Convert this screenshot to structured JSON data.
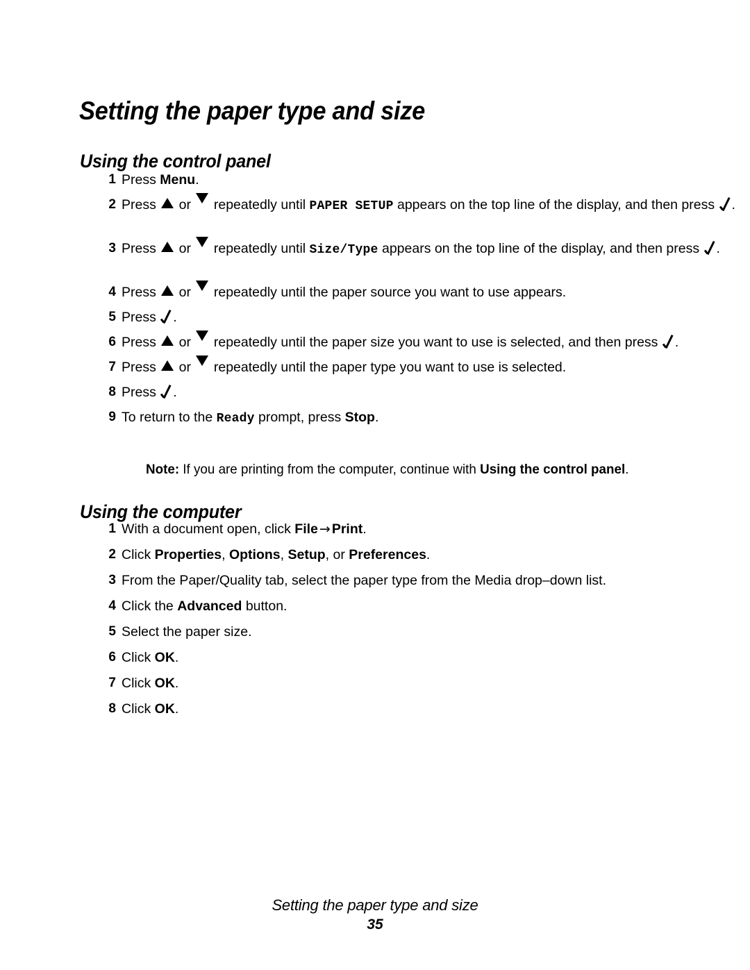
{
  "page": {
    "title": "Setting the paper type and size",
    "footer_title": "Setting the paper type and size",
    "page_number": "35"
  },
  "sections": [
    {
      "heading": "Using the control panel",
      "steps": [
        {
          "number": "1",
          "parts": [
            {
              "t": "text",
              "v": "Press "
            },
            {
              "t": "bold",
              "v": "Menu"
            },
            {
              "t": "text",
              "v": "."
            }
          ]
        },
        {
          "number": "2",
          "parts": [
            {
              "t": "text",
              "v": "Press "
            },
            {
              "t": "icon",
              "v": "triangle-up-icon"
            },
            {
              "t": "text",
              "v": " or "
            },
            {
              "t": "icon",
              "v": "triangle-down-icon"
            },
            {
              "t": "text",
              "v": " repeatedly until "
            },
            {
              "t": "code",
              "v": "PAPER SETUP"
            },
            {
              "t": "text",
              "v": " appears on the top line of the display, and then press "
            },
            {
              "t": "icon",
              "v": "check-icon"
            },
            {
              "t": "text",
              "v": "."
            }
          ]
        },
        {
          "number": "3",
          "parts": [
            {
              "t": "text",
              "v": "Press "
            },
            {
              "t": "icon",
              "v": "triangle-up-icon"
            },
            {
              "t": "text",
              "v": " or "
            },
            {
              "t": "icon",
              "v": "triangle-down-icon"
            },
            {
              "t": "text",
              "v": " repeatedly until "
            },
            {
              "t": "code",
              "v": "Size/Type"
            },
            {
              "t": "text",
              "v": " appears on the top line of the display, and then press "
            },
            {
              "t": "icon",
              "v": "check-icon"
            },
            {
              "t": "text",
              "v": "."
            }
          ]
        },
        {
          "number": "4",
          "parts": [
            {
              "t": "text",
              "v": "Press "
            },
            {
              "t": "icon",
              "v": "triangle-up-icon"
            },
            {
              "t": "text",
              "v": " or "
            },
            {
              "t": "icon",
              "v": "triangle-down-icon"
            },
            {
              "t": "text",
              "v": " repeatedly until the paper source you want to use appears."
            }
          ]
        },
        {
          "number": "5",
          "parts": [
            {
              "t": "text",
              "v": "Press "
            },
            {
              "t": "icon",
              "v": "check-icon"
            },
            {
              "t": "text",
              "v": "."
            }
          ]
        },
        {
          "number": "6",
          "parts": [
            {
              "t": "text",
              "v": "Press "
            },
            {
              "t": "icon",
              "v": "triangle-up-icon"
            },
            {
              "t": "text",
              "v": " or "
            },
            {
              "t": "icon",
              "v": "triangle-down-icon"
            },
            {
              "t": "text",
              "v": " repeatedly until the paper size you want to use is selected, and then press "
            },
            {
              "t": "icon",
              "v": "check-icon"
            },
            {
              "t": "text",
              "v": "."
            }
          ]
        },
        {
          "number": "7",
          "parts": [
            {
              "t": "text",
              "v": "Press "
            },
            {
              "t": "icon",
              "v": "triangle-up-icon"
            },
            {
              "t": "text",
              "v": " or "
            },
            {
              "t": "icon",
              "v": "triangle-down-icon"
            },
            {
              "t": "text",
              "v": " repeatedly until the paper type you want to use is selected."
            }
          ]
        },
        {
          "number": "8",
          "parts": [
            {
              "t": "text",
              "v": "Press "
            },
            {
              "t": "icon",
              "v": "check-icon"
            },
            {
              "t": "text",
              "v": "."
            }
          ]
        },
        {
          "number": "9",
          "parts": [
            {
              "t": "text",
              "v": "To return to the "
            },
            {
              "t": "code",
              "v": "Ready"
            },
            {
              "t": "text",
              "v": " prompt, press "
            },
            {
              "t": "bold",
              "v": "Stop"
            },
            {
              "t": "text",
              "v": "."
            }
          ]
        }
      ],
      "note": [
        {
          "t": "bold",
          "v": "Note:"
        },
        {
          "t": "text",
          "v": " If you are printing from the computer, continue with "
        },
        {
          "t": "bold",
          "v": "Using the control panel"
        },
        {
          "t": "text",
          "v": "."
        }
      ]
    },
    {
      "heading": "Using the computer",
      "steps": [
        {
          "number": "1",
          "parts": [
            {
              "t": "text",
              "v": "With a document open, click "
            },
            {
              "t": "bold",
              "v": "File"
            },
            {
              "t": "arrow",
              "v": "→"
            },
            {
              "t": "bold",
              "v": "Print"
            },
            {
              "t": "text",
              "v": "."
            }
          ]
        },
        {
          "number": "2",
          "parts": [
            {
              "t": "text",
              "v": "Click "
            },
            {
              "t": "bold",
              "v": "Properties"
            },
            {
              "t": "text",
              "v": ", "
            },
            {
              "t": "bold",
              "v": "Options"
            },
            {
              "t": "text",
              "v": ", "
            },
            {
              "t": "bold",
              "v": "Setup"
            },
            {
              "t": "text",
              "v": ", or "
            },
            {
              "t": "bold",
              "v": "Preferences"
            },
            {
              "t": "text",
              "v": "."
            }
          ]
        },
        {
          "number": "3",
          "parts": [
            {
              "t": "text",
              "v": "From the Paper/Quality tab, select the paper type from the Media drop–down list."
            }
          ]
        },
        {
          "number": "4",
          "parts": [
            {
              "t": "text",
              "v": "Click the "
            },
            {
              "t": "bold",
              "v": "Advanced"
            },
            {
              "t": "text",
              "v": " button."
            }
          ]
        },
        {
          "number": "5",
          "parts": [
            {
              "t": "text",
              "v": "Select the paper size."
            }
          ]
        },
        {
          "number": "6",
          "parts": [
            {
              "t": "text",
              "v": "Click "
            },
            {
              "t": "bold",
              "v": "OK"
            },
            {
              "t": "text",
              "v": "."
            }
          ]
        },
        {
          "number": "7",
          "parts": [
            {
              "t": "text",
              "v": "Click "
            },
            {
              "t": "bold",
              "v": "OK"
            },
            {
              "t": "text",
              "v": "."
            }
          ]
        },
        {
          "number": "8",
          "parts": [
            {
              "t": "text",
              "v": "Click "
            },
            {
              "t": "bold",
              "v": "OK"
            },
            {
              "t": "text",
              "v": "."
            }
          ]
        }
      ]
    }
  ]
}
